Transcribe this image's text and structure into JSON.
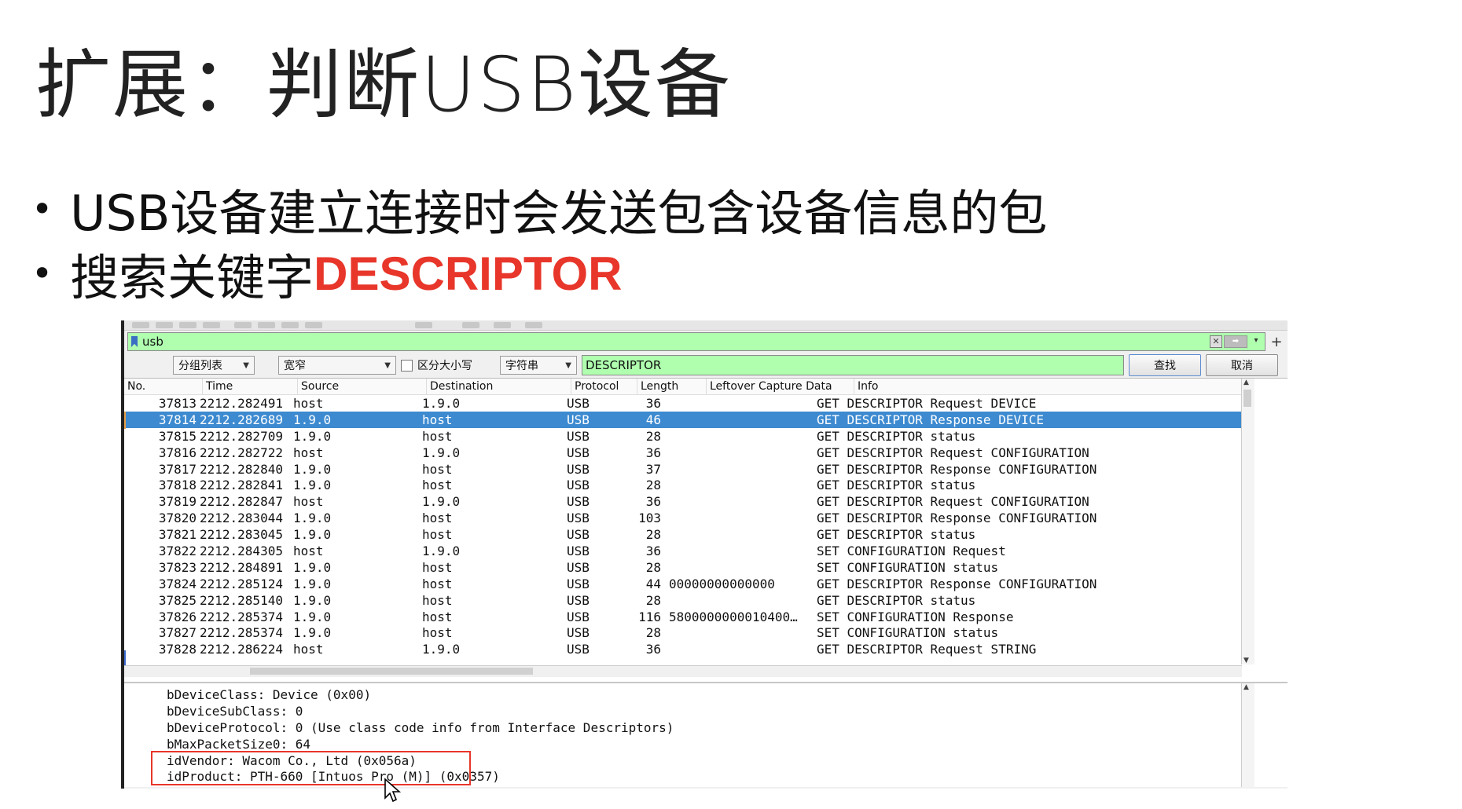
{
  "slide": {
    "title": "扩展：判断USB设备",
    "bullets": [
      {
        "text": "USB设备建立连接时会发送包含设备信息的包",
        "keyword": ""
      },
      {
        "text": "搜索关键字",
        "keyword": "DESCRIPTOR"
      }
    ],
    "keyword_color": "#e8362a"
  },
  "wireshark": {
    "display_filter": "usb",
    "search": {
      "display_mode": "分组列表",
      "char_width": "宽窄",
      "case_sensitive_label": "区分大小写",
      "search_type": "字符串",
      "search_value": "DESCRIPTOR",
      "find_button": "查找",
      "cancel_button": "取消"
    },
    "columns": [
      "No.",
      "Time",
      "Source",
      "Destination",
      "Protocol",
      "Length",
      "Leftover Capture Data",
      "Info"
    ],
    "packets": [
      {
        "no": "37813",
        "time": "2212.282491",
        "src": "host",
        "dst": "1.9.0",
        "proto": "USB",
        "len": "36",
        "leftover": "",
        "info": "GET DESCRIPTOR Request DEVICE"
      },
      {
        "no": "37814",
        "time": "2212.282689",
        "src": "1.9.0",
        "dst": "host",
        "proto": "USB",
        "len": "46",
        "leftover": "",
        "info": "GET DESCRIPTOR Response DEVICE"
      },
      {
        "no": "37815",
        "time": "2212.282709",
        "src": "1.9.0",
        "dst": "host",
        "proto": "USB",
        "len": "28",
        "leftover": "",
        "info": "GET DESCRIPTOR status"
      },
      {
        "no": "37816",
        "time": "2212.282722",
        "src": "host",
        "dst": "1.9.0",
        "proto": "USB",
        "len": "36",
        "leftover": "",
        "info": "GET DESCRIPTOR Request CONFIGURATION"
      },
      {
        "no": "37817",
        "time": "2212.282840",
        "src": "1.9.0",
        "dst": "host",
        "proto": "USB",
        "len": "37",
        "leftover": "",
        "info": "GET DESCRIPTOR Response CONFIGURATION"
      },
      {
        "no": "37818",
        "time": "2212.282841",
        "src": "1.9.0",
        "dst": "host",
        "proto": "USB",
        "len": "28",
        "leftover": "",
        "info": "GET DESCRIPTOR status"
      },
      {
        "no": "37819",
        "time": "2212.282847",
        "src": "host",
        "dst": "1.9.0",
        "proto": "USB",
        "len": "36",
        "leftover": "",
        "info": "GET DESCRIPTOR Request CONFIGURATION"
      },
      {
        "no": "37820",
        "time": "2212.283044",
        "src": "1.9.0",
        "dst": "host",
        "proto": "USB",
        "len": "103",
        "leftover": "",
        "info": "GET DESCRIPTOR Response CONFIGURATION"
      },
      {
        "no": "37821",
        "time": "2212.283045",
        "src": "1.9.0",
        "dst": "host",
        "proto": "USB",
        "len": "28",
        "leftover": "",
        "info": "GET DESCRIPTOR status"
      },
      {
        "no": "37822",
        "time": "2212.284305",
        "src": "host",
        "dst": "1.9.0",
        "proto": "USB",
        "len": "36",
        "leftover": "",
        "info": "SET CONFIGURATION Request"
      },
      {
        "no": "37823",
        "time": "2212.284891",
        "src": "1.9.0",
        "dst": "host",
        "proto": "USB",
        "len": "28",
        "leftover": "",
        "info": "SET CONFIGURATION status"
      },
      {
        "no": "37824",
        "time": "2212.285124",
        "src": "1.9.0",
        "dst": "host",
        "proto": "USB",
        "len": "44",
        "leftover": "00000000000000",
        "info": "GET DESCRIPTOR Response CONFIGURATION"
      },
      {
        "no": "37825",
        "time": "2212.285140",
        "src": "1.9.0",
        "dst": "host",
        "proto": "USB",
        "len": "28",
        "leftover": "",
        "info": "GET DESCRIPTOR status"
      },
      {
        "no": "37826",
        "time": "2212.285374",
        "src": "1.9.0",
        "dst": "host",
        "proto": "USB",
        "len": "116",
        "leftover": "5800000000010400…",
        "info": "SET CONFIGURATION Response"
      },
      {
        "no": "37827",
        "time": "2212.285374",
        "src": "1.9.0",
        "dst": "host",
        "proto": "USB",
        "len": "28",
        "leftover": "",
        "info": "SET CONFIGURATION status"
      },
      {
        "no": "37828",
        "time": "2212.286224",
        "src": "host",
        "dst": "1.9.0",
        "proto": "USB",
        "len": "36",
        "leftover": "",
        "info": "GET DESCRIPTOR Request STRING"
      }
    ],
    "selected_packet": "37814",
    "details": [
      "bDeviceClass: Device (0x00)",
      "bDeviceSubClass: 0",
      "bDeviceProtocol: 0 (Use class code info from Interface Descriptors)",
      "bMaxPacketSize0: 64",
      "idVendor: Wacom Co., Ltd (0x056a)",
      "idProduct: PTH-660 [Intuos Pro (M)] (0x0357)"
    ],
    "colors": {
      "filter_valid": "#afffaf",
      "selected_row": "#3d8ad0",
      "highlight_box": "#e8362a"
    }
  }
}
